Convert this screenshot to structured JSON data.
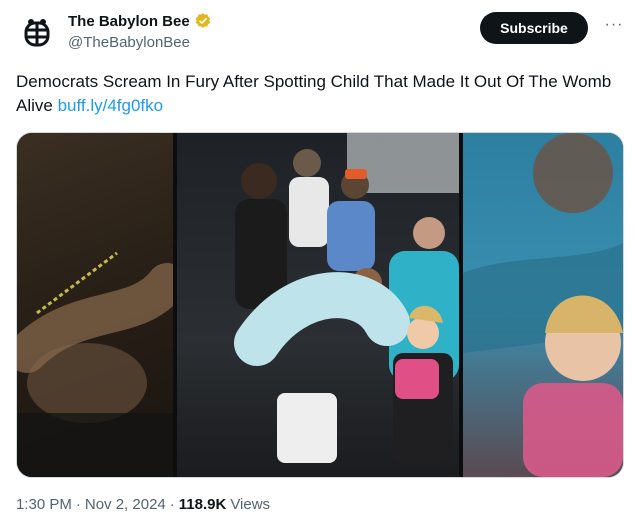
{
  "account": {
    "display_name": "The Babylon Bee",
    "handle": "@TheBabylonBee",
    "verified_color": "#e2b719"
  },
  "actions": {
    "subscribe_label": "Subscribe",
    "more_label": "···"
  },
  "tweet": {
    "text": "Democrats Scream In Fury After Spotting Child That Made It Out Of The Womb Alive ",
    "link_text": "buff.ly/4fg0fko",
    "link_color": "#1d9bf0"
  },
  "media": {
    "panels": [
      "left-crop",
      "center-scene",
      "right-crop"
    ]
  },
  "meta": {
    "time": "1:30 PM",
    "sep1": "·",
    "date": "Nov 2, 2024",
    "sep2": "·",
    "views_count": "118.9K",
    "views_label": "Views"
  }
}
